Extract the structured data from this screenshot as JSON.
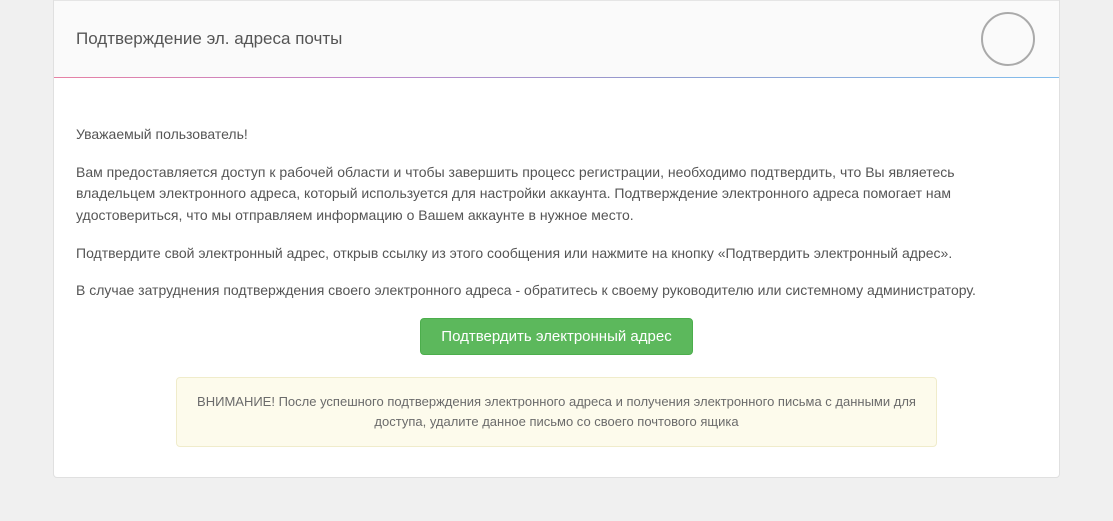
{
  "header": {
    "title": "Подтверждение эл. адреса почты"
  },
  "body": {
    "greeting": "Уважаемый пользователь!",
    "p1": "Вам предоставляется доступ к рабочей области и чтобы завершить процесс регистрации, необходимо подтвердить, что Вы являетесь владельцем электронного адреса, который используется для настройки аккаунта. Подтверждение электронного адреса помогает нам удостовериться, что мы отправляем информацию о Вашем аккаунте в нужное место.",
    "p2": "Подтвердите свой электронный адрес, открыв ссылку из этого сообщения или нажмите на кнопку «Подтвердить электронный адрес».",
    "p3": "В случае затруднения подтверждения своего электронного адреса - обратитесь к своему руководителю или системному администратору.",
    "button_label": "Подтвердить электронный адрес",
    "alert": "ВНИМАНИЕ! После успешного подтверждения электронного адреса и получения электронного письма с данными для доступа, удалите данное письмо со своего почтового ящика"
  }
}
